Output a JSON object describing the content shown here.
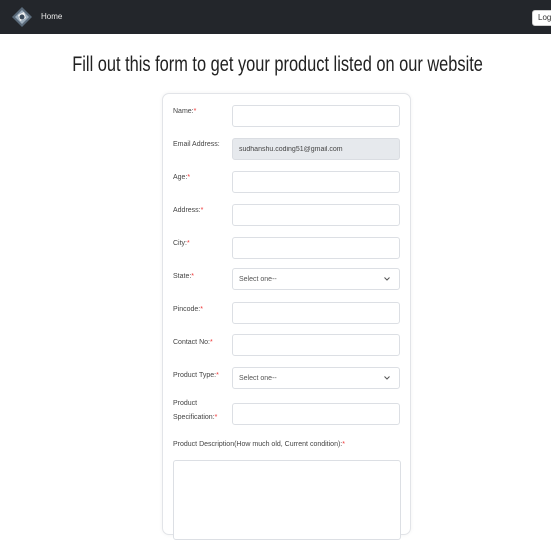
{
  "nav": {
    "home": "Home",
    "logout": "LogOut"
  },
  "page": {
    "title": "Fill out this form to get your product listed on our website"
  },
  "form": {
    "fields": [
      {
        "label": "Name:",
        "value": ""
      },
      {
        "label": "Email Address:",
        "value": "sudhanshu.coding51@gmail.com"
      },
      {
        "label": "Age:",
        "value": ""
      },
      {
        "label": "Address:",
        "value": ""
      },
      {
        "label": "City:",
        "value": ""
      },
      {
        "label": "State:",
        "value": "Select one--"
      },
      {
        "label": "Pincode:",
        "value": ""
      },
      {
        "label": "Contact No:",
        "value": ""
      },
      {
        "label": "Product Type:",
        "value": "Select one--"
      },
      {
        "label": "Product",
        "label2": "Specification:",
        "value": ""
      }
    ],
    "description_label": "Product Description(How much old, Current condition):",
    "required_mark": "*"
  },
  "colors": {
    "navbar": "#23262b",
    "required": "#e33333",
    "disabled_field": "#e6e9ed"
  }
}
